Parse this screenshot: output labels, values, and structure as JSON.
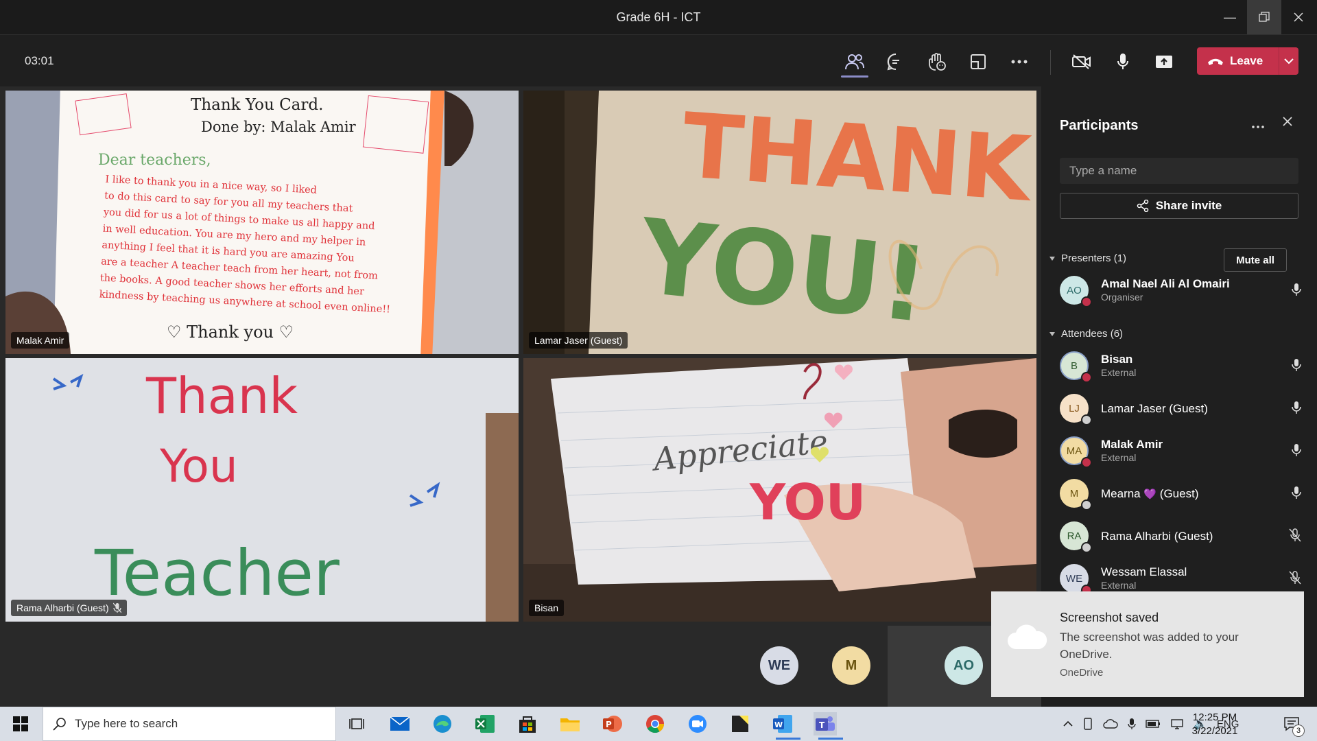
{
  "window": {
    "title": "Grade 6H - ICT"
  },
  "meeting": {
    "timer": "03:01",
    "leave_label": "Leave"
  },
  "tiles": [
    {
      "name": "Malak Amir",
      "muted": false
    },
    {
      "name": "Lamar Jaser (Guest)",
      "muted": false
    },
    {
      "name": "Rama Alharbi (Guest)",
      "muted": true
    },
    {
      "name": "Bisan",
      "muted": false
    }
  ],
  "card1": {
    "title": "Thank You Card.",
    "byline": "Done by: Malak Amir",
    "greeting": "Dear teachers,",
    "body": [
      "I like to thank you in a nice way, so I liked",
      "to do this card to say for you all my teachers that",
      "you did for us a lot of things to make us all happy and",
      "in well education. You are my hero and my helper in",
      "anything I feel that it is hard you are amazing You",
      "are a teacher A teacher teach from her heart, not from",
      "the books. A good teacher shows her efforts and her",
      "kindness by teaching us anywhere at school even online!!"
    ],
    "closing": "♡ Thank you ♡"
  },
  "card2": {
    "line1": "THANK",
    "line2": "YOU!"
  },
  "card3": {
    "line1": "Thank",
    "line2": "You",
    "line3": "Teacher"
  },
  "card4": {
    "line1": "Appreciate",
    "line2": "YOU"
  },
  "bottom_avatars": [
    "WE",
    "M",
    "AO"
  ],
  "panel": {
    "title": "Participants",
    "search_placeholder": "Type a name",
    "share_label": "Share invite",
    "presenters_label": "Presenters (1)",
    "mute_all_label": "Mute all",
    "attendees_label": "Attendees (6)",
    "presenters": [
      {
        "initials": "AO",
        "name": "Amal Nael Ali Al Omairi",
        "role": "Organiser",
        "status": "busy",
        "mic": "on"
      }
    ],
    "attendees": [
      {
        "initials": "B",
        "name": "Bisan",
        "role": "External",
        "status": "busy",
        "mic": "on"
      },
      {
        "initials": "LJ",
        "name": "Lamar Jaser (Guest)",
        "role": "",
        "status": "offline",
        "mic": "on"
      },
      {
        "initials": "MA",
        "name": "Malak Amir",
        "role": "External",
        "status": "busy",
        "mic": "on"
      },
      {
        "initials": "M",
        "name": "Mearna",
        "heart": "💜",
        "suffix": "(Guest)",
        "role": "",
        "status": "offline",
        "mic": "on"
      },
      {
        "initials": "RA",
        "name": "Rama Alharbi (Guest)",
        "role": "",
        "status": "offline",
        "mic": "off"
      },
      {
        "initials": "WE",
        "name": "Wessam Elassal",
        "role": "External",
        "status": "busy",
        "mic": "off"
      }
    ]
  },
  "toast": {
    "title": "Screenshot saved",
    "message": "The screenshot was added to your OneDrive.",
    "source": "OneDrive"
  },
  "taskbar": {
    "search_placeholder": "Type here to search",
    "lang": "ENG",
    "time": "12:25 PM",
    "date": "3/22/2021",
    "notifications": "3"
  },
  "colors": {
    "accent": "#6264a7",
    "leave": "#c4314b",
    "busy": "#c4314b",
    "offline": "#cfcfcf"
  }
}
